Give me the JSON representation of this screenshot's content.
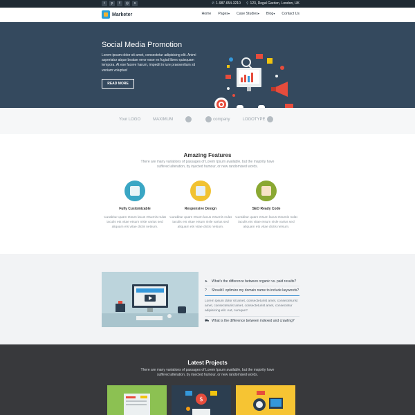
{
  "topbar": {
    "socials": [
      "twitter-icon",
      "pinterest-icon",
      "facebook-icon",
      "instagram-icon",
      "skype-icon"
    ],
    "phone": "1-987-654-3210",
    "address": "123, Regal Garden, London, UK"
  },
  "header": {
    "brand": "Marketer",
    "nav": [
      {
        "label": "Home",
        "caret": ""
      },
      {
        "label": "Pages",
        "caret": "▾"
      },
      {
        "label": "Case Studies",
        "caret": "▾"
      },
      {
        "label": "Blog",
        "caret": "▾"
      },
      {
        "label": "Contact Us",
        "caret": ""
      }
    ]
  },
  "hero": {
    "title": "Social Media Promotion",
    "text": "Lorem ipsum dolor sit amet, consectetur adipisicing elit. Animi asperiatur atque beatae error esse ex fugiat libero quisquam tempora. At ese facere harum, impedit in iure praesentium sit veniam voluptas!",
    "button": "READ MORE",
    "slides": 3,
    "active_slide": 3
  },
  "brands": [
    "Your LOGO",
    "MAXIMUM",
    "",
    "company",
    "LOGOTYPE"
  ],
  "features": {
    "title": "Amazing Features",
    "description": "There are many variations of passages of Lorem Ipsum available, but the majority have suffered alteration, by injected humour, or new randomised words.",
    "items": [
      {
        "title": "Fully Customizable",
        "text": "Curabitur quam etsum lacus etsumis nulat iaculis ets vitae etsum nisle varius sed aliquam ets vitae dictis netsum.",
        "color": "#3aa6c4",
        "inner": "#e9f4f7"
      },
      {
        "title": "Responsive Design",
        "text": "Curabitur quam etsum lacus etsumis nulat iaculis ets vitae etsum nisle varius sed aliquam ets vitae dictis netsum.",
        "color": "#f1c232",
        "inner": "#e7f0f7"
      },
      {
        "title": "SEO Ready Code",
        "text": "Curabitur quam etsum lacus etsumis nulat iaculis ets vitae etsum nisle varius sed aliquam ets vitae dictis netsum.",
        "color": "#8aa832",
        "inner": "#f7e3c5"
      }
    ]
  },
  "faq": {
    "questions": [
      {
        "icon": "paper-plane-icon",
        "glyph": "➤",
        "text": "What's the difference between organic vs. paid results?"
      },
      {
        "icon": "question-icon",
        "glyph": "?",
        "text": "Should I optimize my domain name to include keywords?"
      }
    ],
    "answer": "Lorem ipsum dolor sit amet, consecteturist amet, consecteturist amet, consecteturist amet, consecteturist amet, consectetur adipisicing elit. Aut, cumque?",
    "last_question": {
      "icon": "car-icon",
      "glyph": "⛟",
      "text": "What is the difference between indexed and crawling?"
    }
  },
  "projects": {
    "title": "Latest Projects",
    "description": "There are many variations of passages of Lorem Ipsum available, but the majority have suffered alteration, by injected humour, or new randomised words.",
    "thumb_colors": [
      "#8cc152",
      "#2c3e50",
      "#f6c433"
    ]
  },
  "colors": {
    "hero_bg": "#34495e",
    "topbar_bg": "#1f2a33",
    "projects_bg": "#38393c",
    "accent": "#3b8fd0"
  }
}
